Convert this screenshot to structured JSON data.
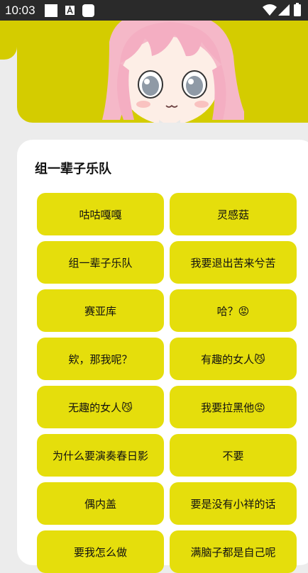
{
  "status_bar": {
    "time": "10:03"
  },
  "colors": {
    "accent": "#e5de0c",
    "banner": "#d4cc00",
    "card": "#ffffff",
    "background": "#ececec"
  },
  "section": {
    "title": "组一辈子乐队"
  },
  "buttons": [
    "咕咕嘎嘎",
    "灵感菇",
    "组一辈子乐队",
    "我要退出苦来兮苦",
    "赛亚库",
    "哈？😡",
    "欸，那我呢？",
    "有趣的女人😼",
    "无趣的女人😼",
    "我要拉黑他😡",
    "为什么要演奏春日影",
    "不要",
    "偶内盖",
    "要是没有小祥的话",
    "要我怎么做",
    "满脑子都是自己呢"
  ]
}
